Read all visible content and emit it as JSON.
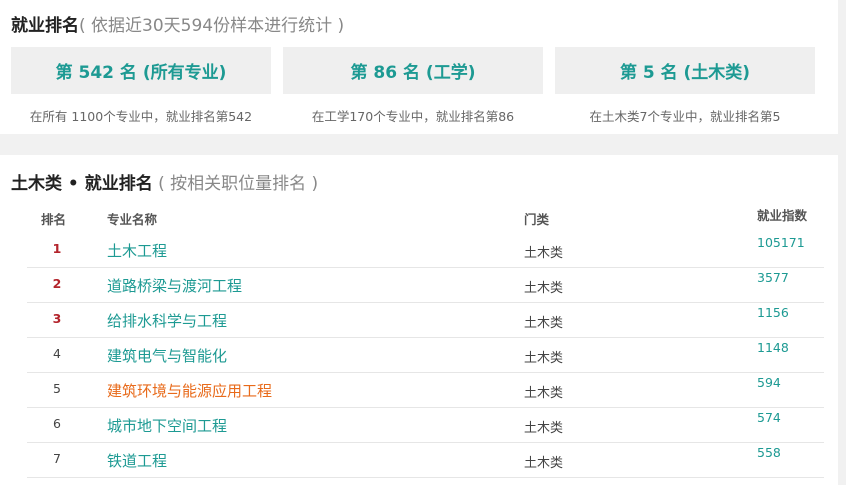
{
  "overview": {
    "title": "就业排名",
    "subtitle": "( 依据近30天594份样本进行统计 )",
    "stats": [
      {
        "label": "第 542 名 (所有专业)",
        "desc": "在所有 1100个专业中，就业排名第542"
      },
      {
        "label": "第 86 名 (工学)",
        "desc": "在工学170个专业中，就业排名第86"
      },
      {
        "label": "第 5 名 (土木类)",
        "desc": "在土木类7个专业中，就业排名第5"
      }
    ]
  },
  "ranking": {
    "title": "土木类 • 就业排名",
    "subtitle": "( 按相关职位量排名 )",
    "headers": {
      "rank": "排名",
      "name": "专业名称",
      "category": "门类",
      "index": "就业指数"
    },
    "rows": [
      {
        "rank": "1",
        "name": "土木工程",
        "category": "土木类",
        "index": "105171"
      },
      {
        "rank": "2",
        "name": "道路桥梁与渡河工程",
        "category": "土木类",
        "index": "3577"
      },
      {
        "rank": "3",
        "name": "给排水科学与工程",
        "category": "土木类",
        "index": "1156"
      },
      {
        "rank": "4",
        "name": "建筑电气与智能化",
        "category": "土木类",
        "index": "1148"
      },
      {
        "rank": "5",
        "name": "建筑环境与能源应用工程",
        "category": "土木类",
        "index": "594"
      },
      {
        "rank": "6",
        "name": "城市地下空间工程",
        "category": "土木类",
        "index": "574"
      },
      {
        "rank": "7",
        "name": "铁道工程",
        "category": "土木类",
        "index": "558"
      }
    ]
  },
  "colors": {
    "accent": "#1d9a93",
    "top_rank": "#b3242c",
    "highlight": "#e86a1a"
  }
}
